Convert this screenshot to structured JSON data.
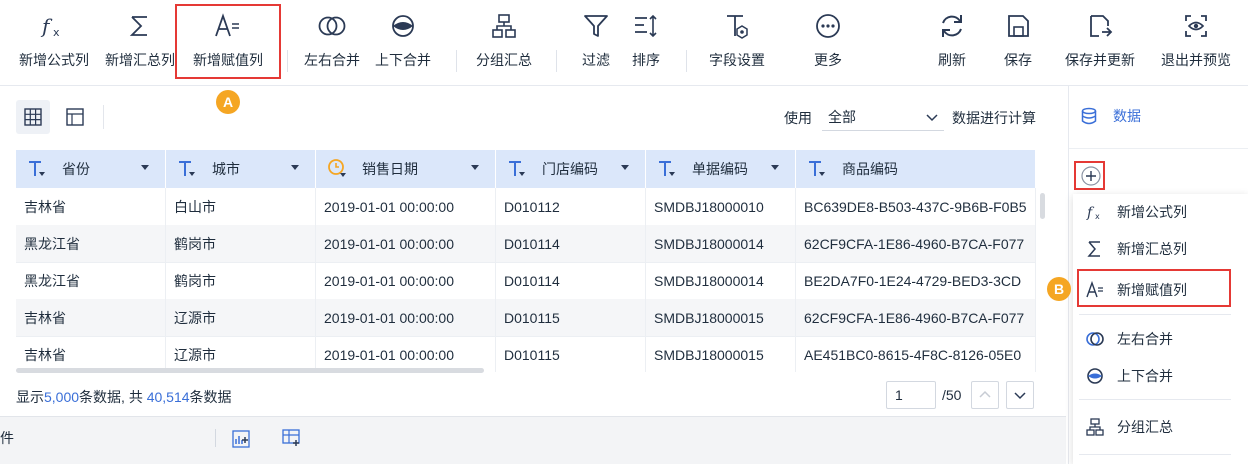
{
  "toolbar": {
    "items": [
      {
        "label": "新增公式列",
        "icon": "formula-icon"
      },
      {
        "label": "新增汇总列",
        "icon": "sigma-icon"
      },
      {
        "label": "新增赋值列",
        "icon": "assign-icon"
      },
      {
        "label": "左右合并",
        "icon": "merge-lr-icon"
      },
      {
        "label": "上下合并",
        "icon": "merge-ud-icon"
      },
      {
        "label": "分组汇总",
        "icon": "group-icon"
      },
      {
        "label": "过滤",
        "icon": "filter-icon"
      },
      {
        "label": "排序",
        "icon": "sort-icon"
      },
      {
        "label": "字段设置",
        "icon": "field-settings-icon"
      },
      {
        "label": "更多",
        "icon": "more-icon"
      },
      {
        "label": "刷新",
        "icon": "refresh-icon"
      },
      {
        "label": "保存",
        "icon": "save-icon"
      },
      {
        "label": "保存并更新",
        "icon": "save-update-icon"
      },
      {
        "label": "退出并预览",
        "icon": "exit-preview-icon"
      }
    ]
  },
  "annotations": {
    "a": "A",
    "b": "B"
  },
  "calc": {
    "use_label": "使用",
    "scope_value": "全部",
    "suffix_label": "数据进行计算"
  },
  "table": {
    "columns": [
      {
        "name": "省份",
        "type": "text"
      },
      {
        "name": "城市",
        "type": "text"
      },
      {
        "name": "销售日期",
        "type": "date"
      },
      {
        "name": "门店编码",
        "type": "text"
      },
      {
        "name": "单据编码",
        "type": "text"
      },
      {
        "name": "商品编码",
        "type": "text"
      }
    ],
    "rows": [
      [
        "吉林省",
        "白山市",
        "2019-01-01 00:00:00",
        "D010112",
        "SMDBJ18000010",
        "BC639DE8-B503-437C-9B6B-F0B5"
      ],
      [
        "黑龙江省",
        "鹤岗市",
        "2019-01-01 00:00:00",
        "D010114",
        "SMDBJ18000014",
        "62CF9CFA-1E86-4960-B7CA-F077"
      ],
      [
        "黑龙江省",
        "鹤岗市",
        "2019-01-01 00:00:00",
        "D010114",
        "SMDBJ18000014",
        "BE2DA7F0-1E24-4729-BED3-3CD"
      ],
      [
        "吉林省",
        "辽源市",
        "2019-01-01 00:00:00",
        "D010115",
        "SMDBJ18000015",
        "62CF9CFA-1E86-4960-B7CA-F077"
      ],
      [
        "吉林省",
        "辽源市",
        "2019-01-01 00:00:00",
        "D010115",
        "SMDBJ18000015",
        "AE451BC0-8615-4F8C-8126-05E0"
      ]
    ]
  },
  "footer": {
    "prefix": "显示",
    "shown": "5,000",
    "mid": "条数据, 共",
    "total": "40,514",
    "suffix": "条数据",
    "page": "1",
    "page_total": "/50"
  },
  "bottom_bar": {
    "text": "件"
  },
  "right_panel": {
    "data_label": "数据",
    "menu": [
      {
        "label": "新增公式列",
        "icon": "formula-icon"
      },
      {
        "label": "新增汇总列",
        "icon": "sigma-icon"
      },
      {
        "label": "新增赋值列",
        "icon": "assign-icon"
      },
      {
        "label": "左右合并",
        "icon": "merge-lr-icon"
      },
      {
        "label": "上下合并",
        "icon": "merge-ud-icon"
      },
      {
        "label": "分组汇总",
        "icon": "group-icon"
      }
    ]
  },
  "colors": {
    "accent": "#3a6fd8",
    "header_bg": "#dbe7fa",
    "highlight": "#e53935",
    "badge": "#f5a623",
    "date_icon": "#f5a623"
  }
}
